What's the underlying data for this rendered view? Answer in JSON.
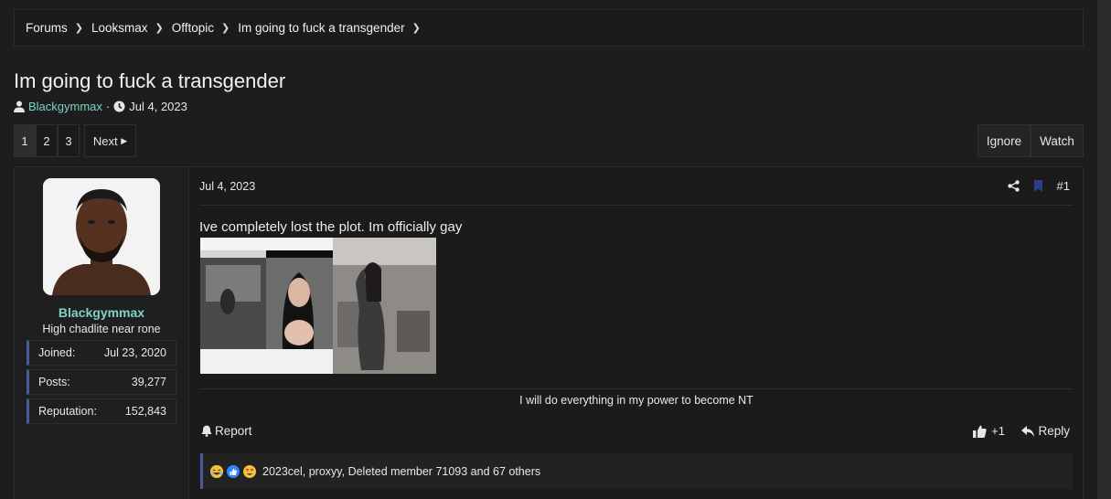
{
  "breadcrumb": [
    "Forums",
    "Looksmax",
    "Offtopic",
    "Im going to fuck a transgender"
  ],
  "thread": {
    "title": "Im going to fuck a transgender",
    "author": "Blackgymmax",
    "date": "Jul 4, 2023"
  },
  "pager": {
    "pages": [
      "1",
      "2",
      "3"
    ],
    "next": "Next"
  },
  "actions": {
    "ignore": "Ignore",
    "watch": "Watch"
  },
  "user": {
    "name": "Blackgymmax",
    "title": "High chadlite near rone",
    "stats": [
      {
        "label": "Joined:",
        "value": "Jul 23, 2020"
      },
      {
        "label": "Posts:",
        "value": "39,277"
      },
      {
        "label": "Reputation:",
        "value": "152,843"
      }
    ]
  },
  "post": {
    "date": "Jul 4, 2023",
    "number": "#1",
    "message": "Ive completely lost the plot. Im officially gay",
    "signature": "I will do everything in my power to become NT",
    "report": "Report",
    "like_count": "+1",
    "reply": "Reply",
    "reactions_text": "2023cel, proxyy, Deleted member 71093 and 67 others"
  },
  "colors": {
    "accent_user": "#7fd3c7",
    "bar": "#4a5a9a"
  }
}
